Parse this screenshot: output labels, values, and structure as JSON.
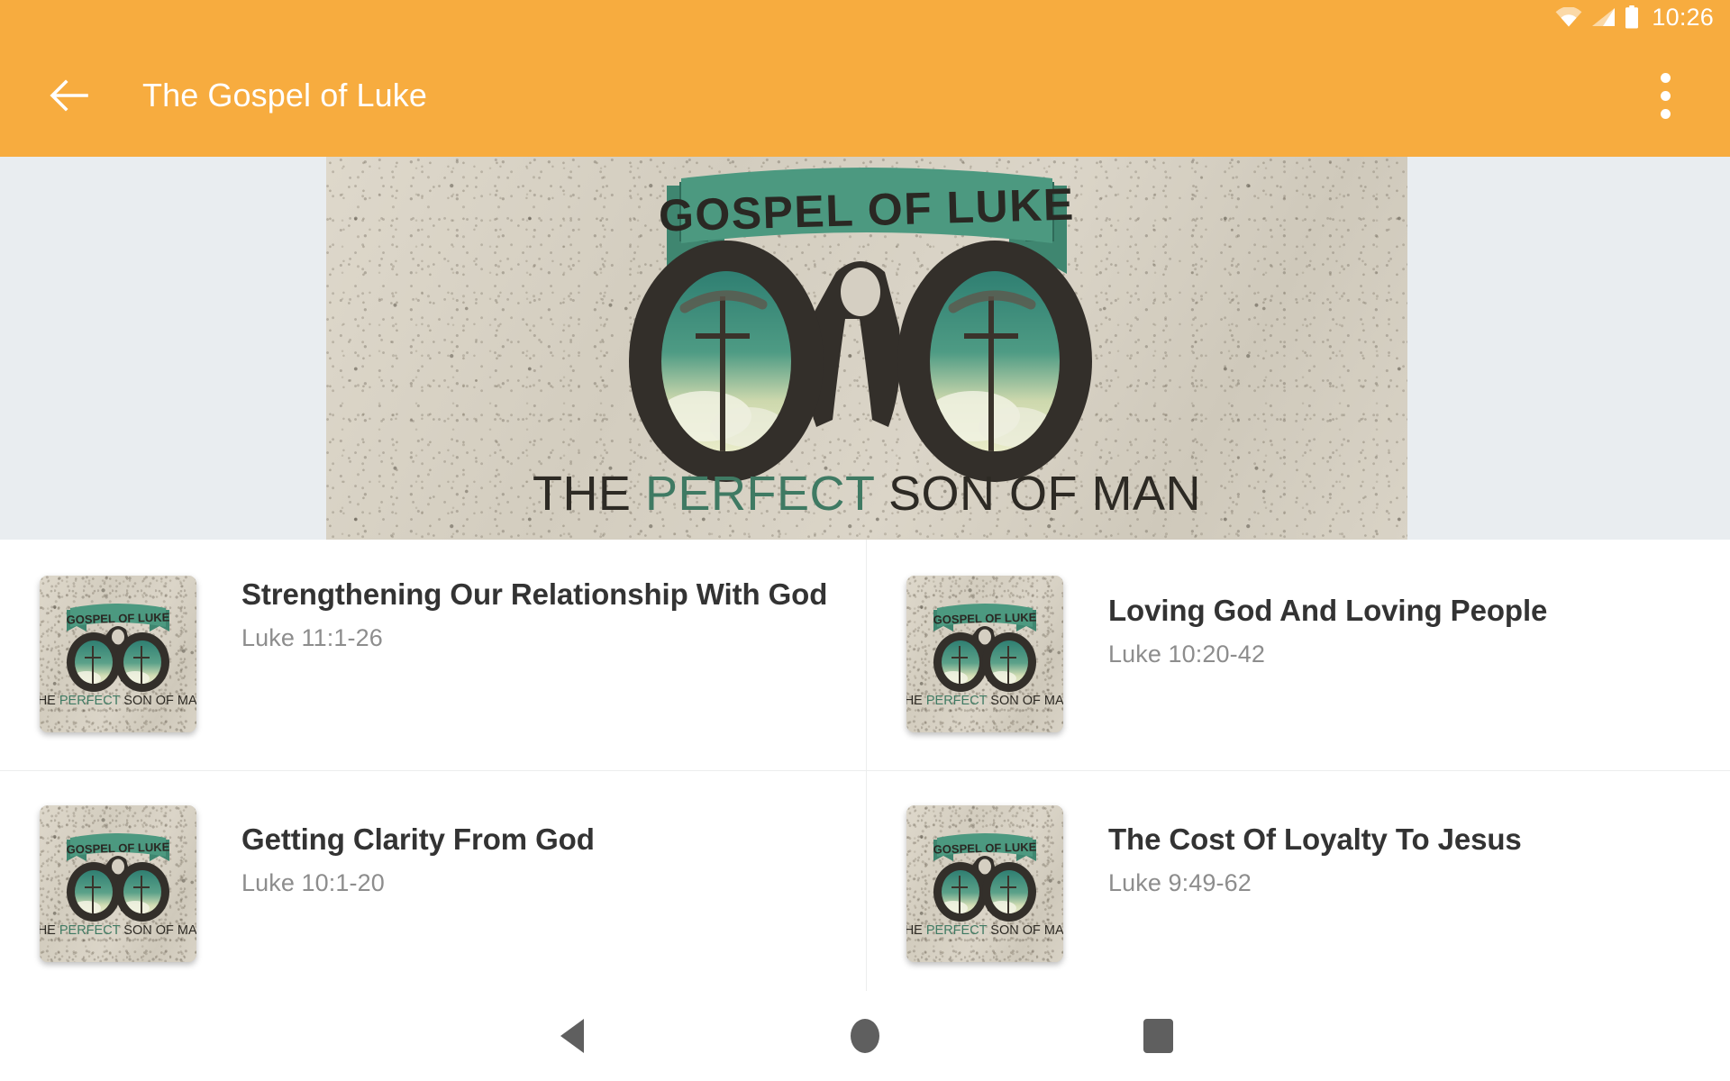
{
  "status_bar": {
    "time": "10:26",
    "icons": [
      "wifi-icon",
      "signal-icon",
      "battery-icon"
    ]
  },
  "app_bar": {
    "title": "The Gospel of Luke",
    "back_icon": "back-arrow-icon",
    "overflow_icon": "overflow-menu-icon",
    "background_color": "#F7AC3F",
    "text_color": "#FFFFFF"
  },
  "hero": {
    "banner_title": "GOSPEL OF LUKE",
    "banner_subtitle_part1": "THE ",
    "banner_subtitle_accent": "PERFECT",
    "banner_subtitle_part2": " SON OF MAN",
    "artwork": "binoculars-with-cross-icon",
    "ribbon_color": "#4C9980",
    "background_color": "#E9EDF0"
  },
  "list": {
    "items": [
      {
        "title": "Strengthening Our Relationship With God",
        "reference": "Luke 11:1-26",
        "thumbnail": "gospel-of-luke-thumbnail"
      },
      {
        "title": "Loving God And Loving People",
        "reference": "Luke 10:20-42",
        "thumbnail": "gospel-of-luke-thumbnail"
      },
      {
        "title": "Getting Clarity From God",
        "reference": "Luke 10:1-20",
        "thumbnail": "gospel-of-luke-thumbnail"
      },
      {
        "title": "The Cost Of Loyalty To Jesus",
        "reference": "Luke 9:49-62",
        "thumbnail": "gospel-of-luke-thumbnail"
      }
    ],
    "title_color": "#333333",
    "reference_color": "#8D8D8D",
    "divider_color": "#ECEDED"
  },
  "nav_bar": {
    "back_icon": "triangle-back-icon",
    "home_icon": "circle-home-icon",
    "recents_icon": "square-recents-icon",
    "icon_color": "#5F5F5F"
  }
}
